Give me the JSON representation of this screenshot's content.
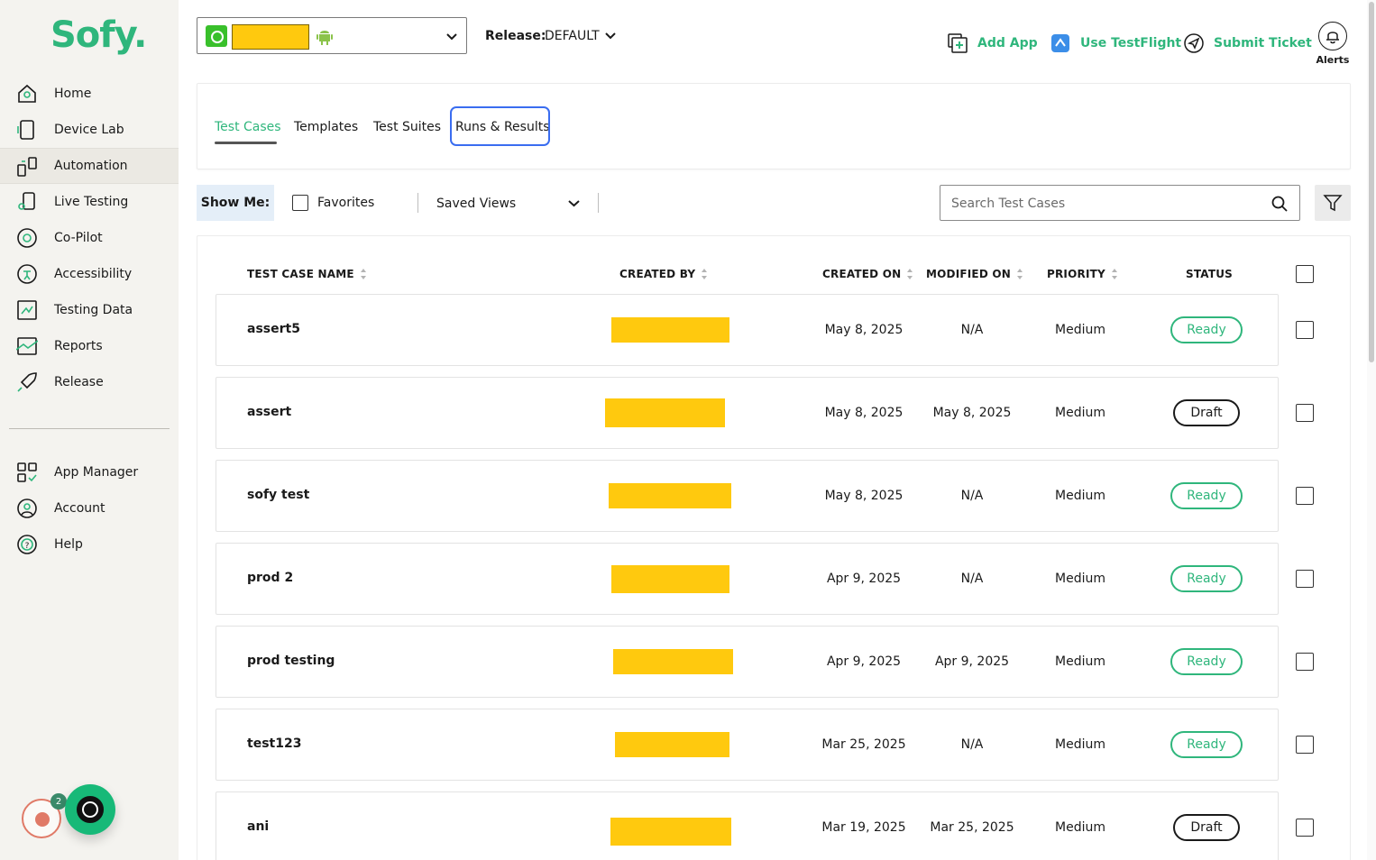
{
  "brand": {
    "logo_text": "Sofy."
  },
  "sidebar": {
    "items": [
      {
        "label": "Home",
        "icon": "home-icon"
      },
      {
        "label": "Device Lab",
        "icon": "device-icon"
      },
      {
        "label": "Automation",
        "icon": "automation-icon",
        "active": true
      },
      {
        "label": "Live Testing",
        "icon": "live-testing-icon"
      },
      {
        "label": "Co-Pilot",
        "icon": "copilot-icon"
      },
      {
        "label": "Accessibility",
        "icon": "accessibility-icon"
      },
      {
        "label": "Testing Data",
        "icon": "testing-data-icon"
      },
      {
        "label": "Reports",
        "icon": "reports-icon"
      },
      {
        "label": "Release",
        "icon": "rocket-icon"
      }
    ],
    "secondary_items": [
      {
        "label": "App Manager",
        "icon": "app-manager-icon"
      },
      {
        "label": "Account",
        "icon": "account-icon"
      },
      {
        "label": "Help",
        "icon": "help-icon"
      }
    ],
    "recorder_badge_count": "2"
  },
  "topbar": {
    "release_label": "Release:",
    "release_value": "DEFAULT",
    "actions": {
      "add_app": "Add App",
      "use_testflight": "Use TestFlight",
      "submit_ticket": "Submit Ticket"
    },
    "alerts_label": "Alerts"
  },
  "tabs": [
    {
      "label": "Test Cases",
      "active": true
    },
    {
      "label": "Templates"
    },
    {
      "label": "Test Suites"
    },
    {
      "label": "Runs & Results",
      "focused": true
    }
  ],
  "toolbar": {
    "show_me_label": "Show Me:",
    "favorites_label": "Favorites",
    "saved_views_label": "Saved Views",
    "search_placeholder": "Search Test Cases"
  },
  "table": {
    "columns": {
      "name": "TEST CASE NAME",
      "created_by": "CREATED BY",
      "created_on": "CREATED ON",
      "modified_on": "MODIFIED ON",
      "priority": "PRIORITY",
      "status": "STATUS"
    },
    "rows": [
      {
        "name": "assert5",
        "created_on": "May 8, 2025",
        "modified_on": "N/A",
        "priority": "Medium",
        "status": "Ready"
      },
      {
        "name": "assert",
        "created_on": "May 8, 2025",
        "modified_on": "May 8, 2025",
        "priority": "Medium",
        "status": "Draft"
      },
      {
        "name": "sofy test",
        "created_on": "May 8, 2025",
        "modified_on": "N/A",
        "priority": "Medium",
        "status": "Ready"
      },
      {
        "name": "prod 2",
        "created_on": "Apr 9, 2025",
        "modified_on": "N/A",
        "priority": "Medium",
        "status": "Ready"
      },
      {
        "name": "prod testing",
        "created_on": "Apr 9, 2025",
        "modified_on": "Apr 9, 2025",
        "priority": "Medium",
        "status": "Ready"
      },
      {
        "name": "test123",
        "created_on": "Mar 25, 2025",
        "modified_on": "N/A",
        "priority": "Medium",
        "status": "Ready"
      },
      {
        "name": "ani",
        "created_on": "Mar 19, 2025",
        "modified_on": "Mar 25, 2025",
        "priority": "Medium",
        "status": "Draft"
      }
    ]
  },
  "colors": {
    "brand_green": "#2fb67c",
    "redaction_yellow": "#ffc90e",
    "focus_blue": "#3a6df0",
    "sidebar_bg": "#f4f3ef"
  }
}
